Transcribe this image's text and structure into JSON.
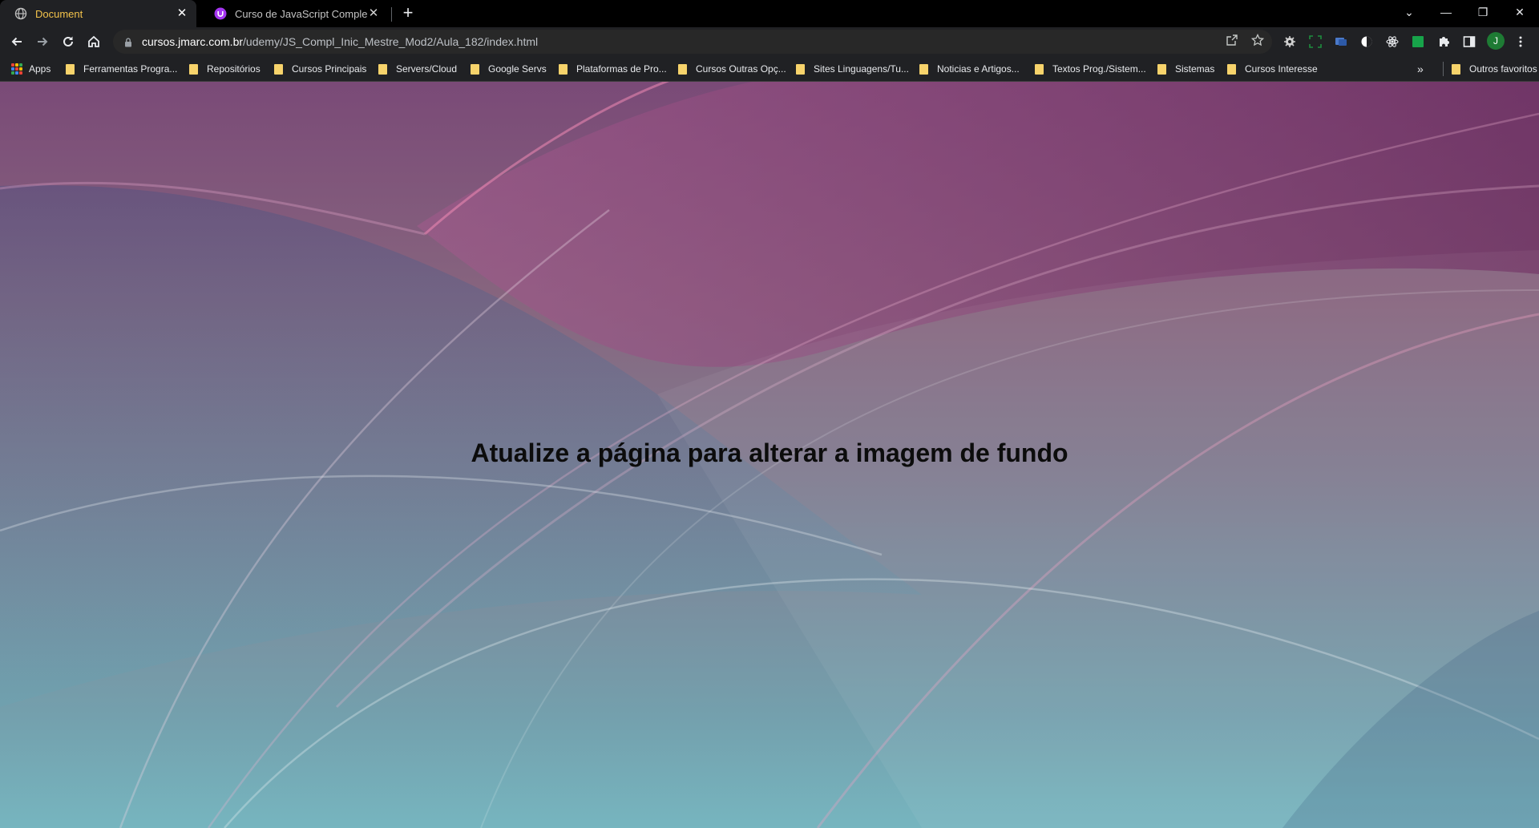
{
  "tabs": [
    {
      "title": "Document",
      "close_label": "✕",
      "icon": "globe-icon",
      "active": true
    },
    {
      "title": "Curso de JavaScript Completo do",
      "close_label": "✕",
      "icon": "udemy-icon",
      "active": false
    }
  ],
  "new_tab_label": "+",
  "window_controls": {
    "tab_search": "⌄",
    "minimize": "—",
    "restore": "❐",
    "close": "✕"
  },
  "address_bar": {
    "host": "cursos.jmarc.com.br",
    "path": "/udemy/JS_Compl_Inic_Mestre_Mod2/Aula_182/index.html"
  },
  "profile_initial": "J",
  "bookmarks": {
    "apps_label": "Apps",
    "folders": [
      "Ferramentas Progra...",
      "Repositórios",
      "Cursos Principais",
      "Servers/Cloud",
      "Google Servs",
      "Plataformas de Pro...",
      "Cursos Outras Opç...",
      "Sites Linguagens/Tu...",
      "Noticias e Artigos...",
      "Textos Prog./Sistem...",
      "Sistemas",
      "Cursos Interesse"
    ],
    "overflow_label": "»",
    "other_bookmarks": "Outros favoritos"
  },
  "page": {
    "heading": "Atualize a página para alterar a imagem de fundo"
  },
  "colors": {
    "active_tab_text": "#f3c34b",
    "folder": "#f7d36b",
    "background_top": "#7a4a77",
    "background_bottom": "#76b5bf",
    "heading": "#0c0c0c"
  }
}
